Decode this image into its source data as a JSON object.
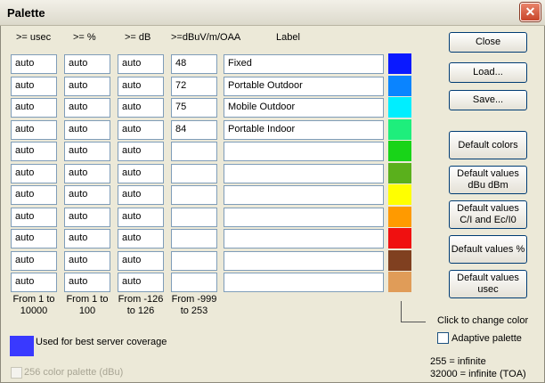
{
  "window": {
    "title": "Palette",
    "close_glyph": "✕"
  },
  "columns": [
    ">= usec",
    ">= %",
    ">= dB",
    ">=dBuV/m/OAA",
    "Label"
  ],
  "rows": [
    {
      "usec": "auto",
      "pct": "auto",
      "db": "auto",
      "dbuv": "48",
      "label": "Fixed",
      "color": "#0a19ff"
    },
    {
      "usec": "auto",
      "pct": "auto",
      "db": "auto",
      "dbuv": "72",
      "label": "Portable Outdoor",
      "color": "#0a84ff"
    },
    {
      "usec": "auto",
      "pct": "auto",
      "db": "auto",
      "dbuv": "75",
      "label": "Mobile Outdoor",
      "color": "#00eeff"
    },
    {
      "usec": "auto",
      "pct": "auto",
      "db": "auto",
      "dbuv": "84",
      "label": "Portable Indoor",
      "color": "#1eee7c"
    },
    {
      "usec": "auto",
      "pct": "auto",
      "db": "auto",
      "dbuv": "",
      "label": "",
      "color": "#18d418"
    },
    {
      "usec": "auto",
      "pct": "auto",
      "db": "auto",
      "dbuv": "",
      "label": "",
      "color": "#5ab01c"
    },
    {
      "usec": "auto",
      "pct": "auto",
      "db": "auto",
      "dbuv": "",
      "label": "",
      "color": "#ffff00"
    },
    {
      "usec": "auto",
      "pct": "auto",
      "db": "auto",
      "dbuv": "",
      "label": "",
      "color": "#ff9a00"
    },
    {
      "usec": "auto",
      "pct": "auto",
      "db": "auto",
      "dbuv": "",
      "label": "",
      "color": "#f01010"
    },
    {
      "usec": "auto",
      "pct": "auto",
      "db": "auto",
      "dbuv": "",
      "label": "",
      "color": "#804020"
    },
    {
      "usec": "auto",
      "pct": "auto",
      "db": "auto",
      "dbuv": "",
      "label": "",
      "color": "#e09c58"
    }
  ],
  "ranges": {
    "usec": [
      "From 1 to",
      "10000"
    ],
    "pct": [
      "From 1 to",
      "100"
    ],
    "db": [
      "From -126",
      "to 126"
    ],
    "dbuv": [
      "From -999",
      "to 253"
    ]
  },
  "legend": {
    "color": "#3939ff",
    "text": "Used for best server coverage"
  },
  "palette256": {
    "label": "256 color palette (dBu)",
    "checked": false,
    "enabled": false
  },
  "buttons": {
    "close": "Close",
    "load": "Load...",
    "save": "Save...",
    "default_colors": "Default colors",
    "default_values_dbu_line1": "Default values",
    "default_values_dbu_line2": "dBu dBm",
    "default_values_ci_line1": "Default values",
    "default_values_ci_line2": "C/I and Ec/I0",
    "default_values_pct": "Default values %",
    "default_values_usec_line1": "Default values",
    "default_values_usec_line2": "usec"
  },
  "color_hint": "Click to change color",
  "adaptive": {
    "label": "Adaptive palette",
    "checked": false
  },
  "notes": {
    "infinite": "255 = infinite",
    "infinite_toa": "32000 = infinite (TOA)"
  }
}
